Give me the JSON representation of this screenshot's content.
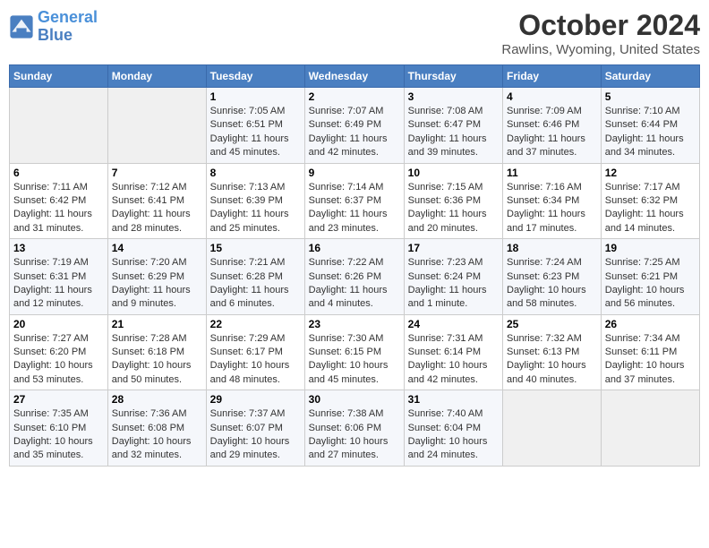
{
  "header": {
    "logo_general": "General",
    "logo_blue": "Blue",
    "month": "October 2024",
    "location": "Rawlins, Wyoming, United States"
  },
  "weekdays": [
    "Sunday",
    "Monday",
    "Tuesday",
    "Wednesday",
    "Thursday",
    "Friday",
    "Saturday"
  ],
  "weeks": [
    [
      {
        "day": "",
        "info": ""
      },
      {
        "day": "",
        "info": ""
      },
      {
        "day": "1",
        "info": "Sunrise: 7:05 AM\nSunset: 6:51 PM\nDaylight: 11 hours and 45 minutes."
      },
      {
        "day": "2",
        "info": "Sunrise: 7:07 AM\nSunset: 6:49 PM\nDaylight: 11 hours and 42 minutes."
      },
      {
        "day": "3",
        "info": "Sunrise: 7:08 AM\nSunset: 6:47 PM\nDaylight: 11 hours and 39 minutes."
      },
      {
        "day": "4",
        "info": "Sunrise: 7:09 AM\nSunset: 6:46 PM\nDaylight: 11 hours and 37 minutes."
      },
      {
        "day": "5",
        "info": "Sunrise: 7:10 AM\nSunset: 6:44 PM\nDaylight: 11 hours and 34 minutes."
      }
    ],
    [
      {
        "day": "6",
        "info": "Sunrise: 7:11 AM\nSunset: 6:42 PM\nDaylight: 11 hours and 31 minutes."
      },
      {
        "day": "7",
        "info": "Sunrise: 7:12 AM\nSunset: 6:41 PM\nDaylight: 11 hours and 28 minutes."
      },
      {
        "day": "8",
        "info": "Sunrise: 7:13 AM\nSunset: 6:39 PM\nDaylight: 11 hours and 25 minutes."
      },
      {
        "day": "9",
        "info": "Sunrise: 7:14 AM\nSunset: 6:37 PM\nDaylight: 11 hours and 23 minutes."
      },
      {
        "day": "10",
        "info": "Sunrise: 7:15 AM\nSunset: 6:36 PM\nDaylight: 11 hours and 20 minutes."
      },
      {
        "day": "11",
        "info": "Sunrise: 7:16 AM\nSunset: 6:34 PM\nDaylight: 11 hours and 17 minutes."
      },
      {
        "day": "12",
        "info": "Sunrise: 7:17 AM\nSunset: 6:32 PM\nDaylight: 11 hours and 14 minutes."
      }
    ],
    [
      {
        "day": "13",
        "info": "Sunrise: 7:19 AM\nSunset: 6:31 PM\nDaylight: 11 hours and 12 minutes."
      },
      {
        "day": "14",
        "info": "Sunrise: 7:20 AM\nSunset: 6:29 PM\nDaylight: 11 hours and 9 minutes."
      },
      {
        "day": "15",
        "info": "Sunrise: 7:21 AM\nSunset: 6:28 PM\nDaylight: 11 hours and 6 minutes."
      },
      {
        "day": "16",
        "info": "Sunrise: 7:22 AM\nSunset: 6:26 PM\nDaylight: 11 hours and 4 minutes."
      },
      {
        "day": "17",
        "info": "Sunrise: 7:23 AM\nSunset: 6:24 PM\nDaylight: 11 hours and 1 minute."
      },
      {
        "day": "18",
        "info": "Sunrise: 7:24 AM\nSunset: 6:23 PM\nDaylight: 10 hours and 58 minutes."
      },
      {
        "day": "19",
        "info": "Sunrise: 7:25 AM\nSunset: 6:21 PM\nDaylight: 10 hours and 56 minutes."
      }
    ],
    [
      {
        "day": "20",
        "info": "Sunrise: 7:27 AM\nSunset: 6:20 PM\nDaylight: 10 hours and 53 minutes."
      },
      {
        "day": "21",
        "info": "Sunrise: 7:28 AM\nSunset: 6:18 PM\nDaylight: 10 hours and 50 minutes."
      },
      {
        "day": "22",
        "info": "Sunrise: 7:29 AM\nSunset: 6:17 PM\nDaylight: 10 hours and 48 minutes."
      },
      {
        "day": "23",
        "info": "Sunrise: 7:30 AM\nSunset: 6:15 PM\nDaylight: 10 hours and 45 minutes."
      },
      {
        "day": "24",
        "info": "Sunrise: 7:31 AM\nSunset: 6:14 PM\nDaylight: 10 hours and 42 minutes."
      },
      {
        "day": "25",
        "info": "Sunrise: 7:32 AM\nSunset: 6:13 PM\nDaylight: 10 hours and 40 minutes."
      },
      {
        "day": "26",
        "info": "Sunrise: 7:34 AM\nSunset: 6:11 PM\nDaylight: 10 hours and 37 minutes."
      }
    ],
    [
      {
        "day": "27",
        "info": "Sunrise: 7:35 AM\nSunset: 6:10 PM\nDaylight: 10 hours and 35 minutes."
      },
      {
        "day": "28",
        "info": "Sunrise: 7:36 AM\nSunset: 6:08 PM\nDaylight: 10 hours and 32 minutes."
      },
      {
        "day": "29",
        "info": "Sunrise: 7:37 AM\nSunset: 6:07 PM\nDaylight: 10 hours and 29 minutes."
      },
      {
        "day": "30",
        "info": "Sunrise: 7:38 AM\nSunset: 6:06 PM\nDaylight: 10 hours and 27 minutes."
      },
      {
        "day": "31",
        "info": "Sunrise: 7:40 AM\nSunset: 6:04 PM\nDaylight: 10 hours and 24 minutes."
      },
      {
        "day": "",
        "info": ""
      },
      {
        "day": "",
        "info": ""
      }
    ]
  ]
}
